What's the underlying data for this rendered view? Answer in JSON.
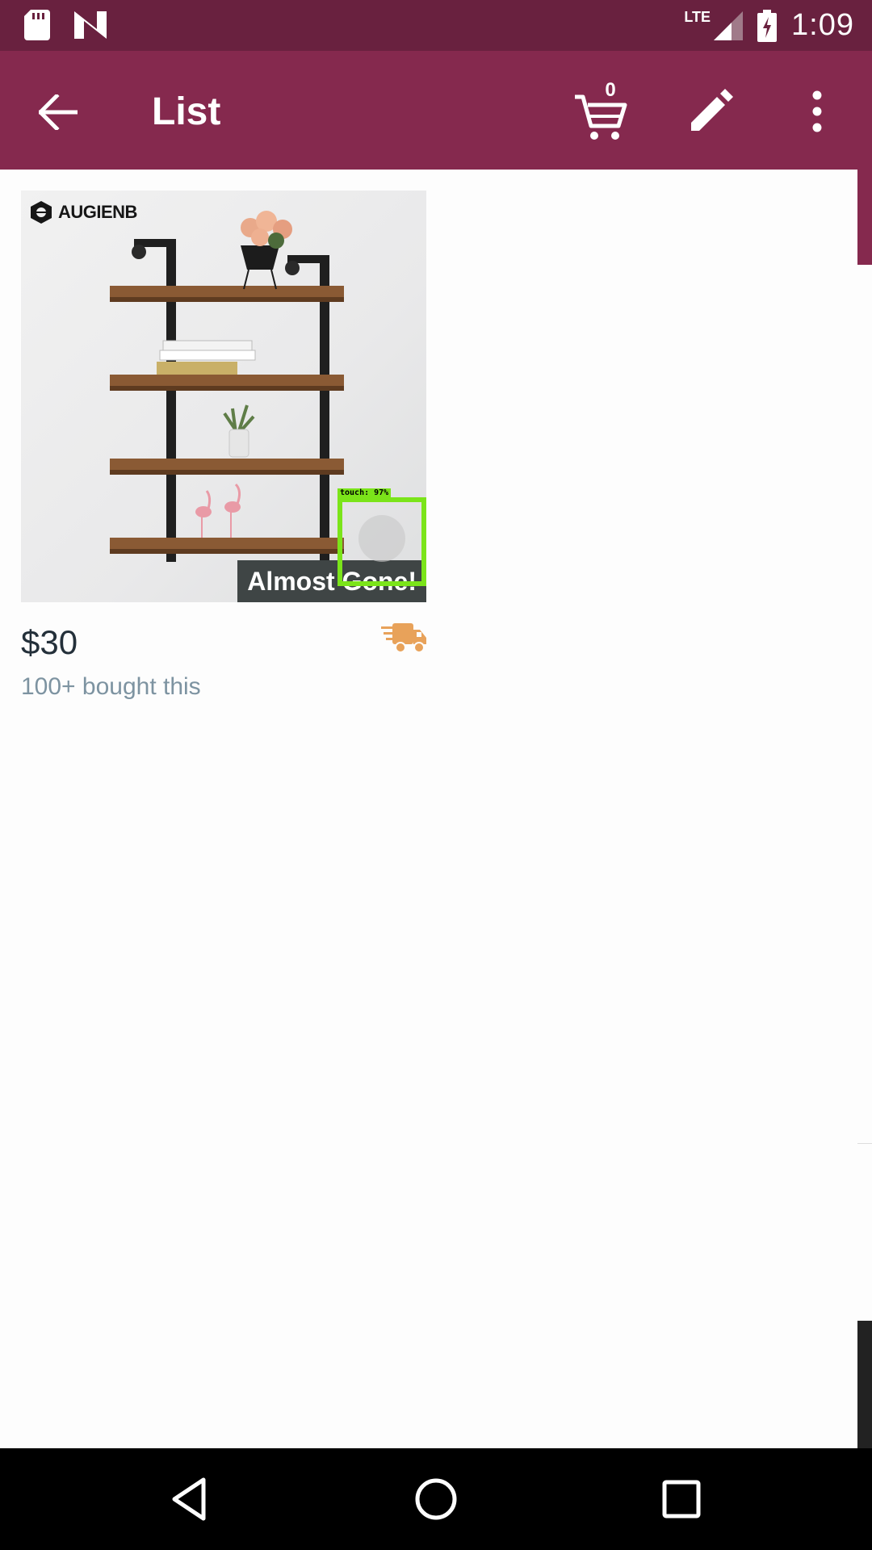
{
  "status_bar": {
    "time": "1:09",
    "network": "LTE",
    "left_icons": [
      "sd-card-icon",
      "n-logo-icon"
    ],
    "right_icons": [
      "signal-icon",
      "battery-charging-icon"
    ]
  },
  "app_bar": {
    "title": "List",
    "cart_count": "0",
    "background": "#85294e",
    "status_background": "#69213f"
  },
  "product": {
    "brand": "AUGIENB",
    "badge": "Almost Gone!",
    "price": "$30",
    "social_proof": "100+ bought this",
    "shipping_icon": "delivery-truck-icon",
    "shipping_color": "#e8a25a",
    "badge_background": "#3f4545"
  },
  "overlay": {
    "touch_label": "touch: 97%",
    "color": "#7be41a"
  },
  "nav_bar": {
    "buttons": [
      "back-triangle-icon",
      "home-circle-icon",
      "recents-square-icon"
    ]
  }
}
